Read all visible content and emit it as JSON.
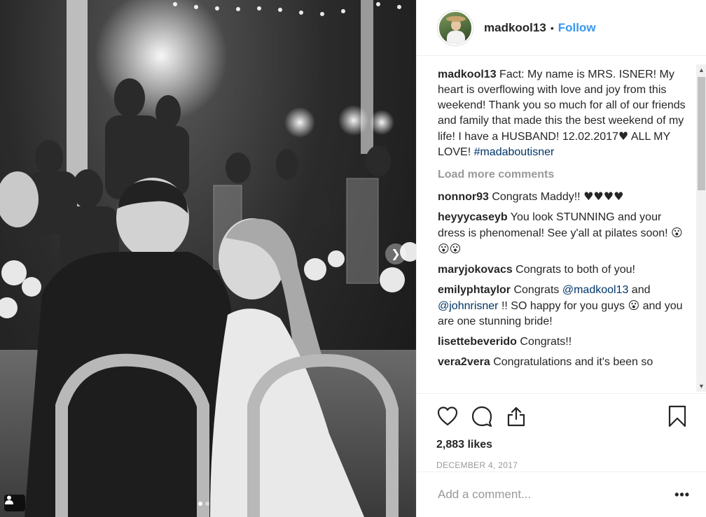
{
  "post": {
    "username": "madkool13",
    "follow_label": "Follow",
    "separator": "•",
    "caption": {
      "username": "madkool13",
      "text_main": " Fact: My name is MRS. ISNER! My heart is overflowing with love and joy from this weekend! Thank you so much for all of our friends and family that made this the best weekend of my life! I have a HUSBAND! 12.02.2017",
      "heart": "♥",
      "text_end": " ALL MY LOVE! ",
      "hashtag": "#madaboutisner"
    },
    "load_more_label": "Load more comments",
    "comments": [
      {
        "user": "nonnor93",
        "text": " Congrats Maddy!! ",
        "emoji": "♥♥♥♥"
      },
      {
        "user": "heyyycaseyb",
        "text": " You look STUNNING and your dress is phenomenal! See y'all at pilates soon! ",
        "emoji": "😮😮😮"
      },
      {
        "user": "maryjokovacs",
        "text": " Congrats to both of you!"
      },
      {
        "user": "emilyphtaylor",
        "text_a": " Congrats ",
        "mention_a": "@madkool13",
        "text_b": " and ",
        "mention_b": "@johnrisner",
        "text_c": " !! SO happy for you guys ",
        "emoji": "😮",
        "text_d": " and you are one stunning bride!"
      },
      {
        "user": "lisettebeverido",
        "text": " Congrats!!"
      },
      {
        "user": "vera2vera",
        "text": " Congratulations and it's been so"
      }
    ],
    "likes": "2,883 likes",
    "date": "DECEMBER 4, 2017",
    "add_comment_placeholder": "Add a comment...",
    "more_options": "•••"
  },
  "carousel": {
    "count": 2,
    "active": 1
  },
  "icons": {
    "like": "heart-outline-icon",
    "comment": "speech-bubble-icon",
    "share": "share-upload-icon",
    "save": "bookmark-icon",
    "tag": "user-tag-icon",
    "next": "chevron-right-icon"
  },
  "colors": {
    "link": "#3897f0",
    "mention": "#003569",
    "muted": "#999999",
    "text": "#262626"
  }
}
